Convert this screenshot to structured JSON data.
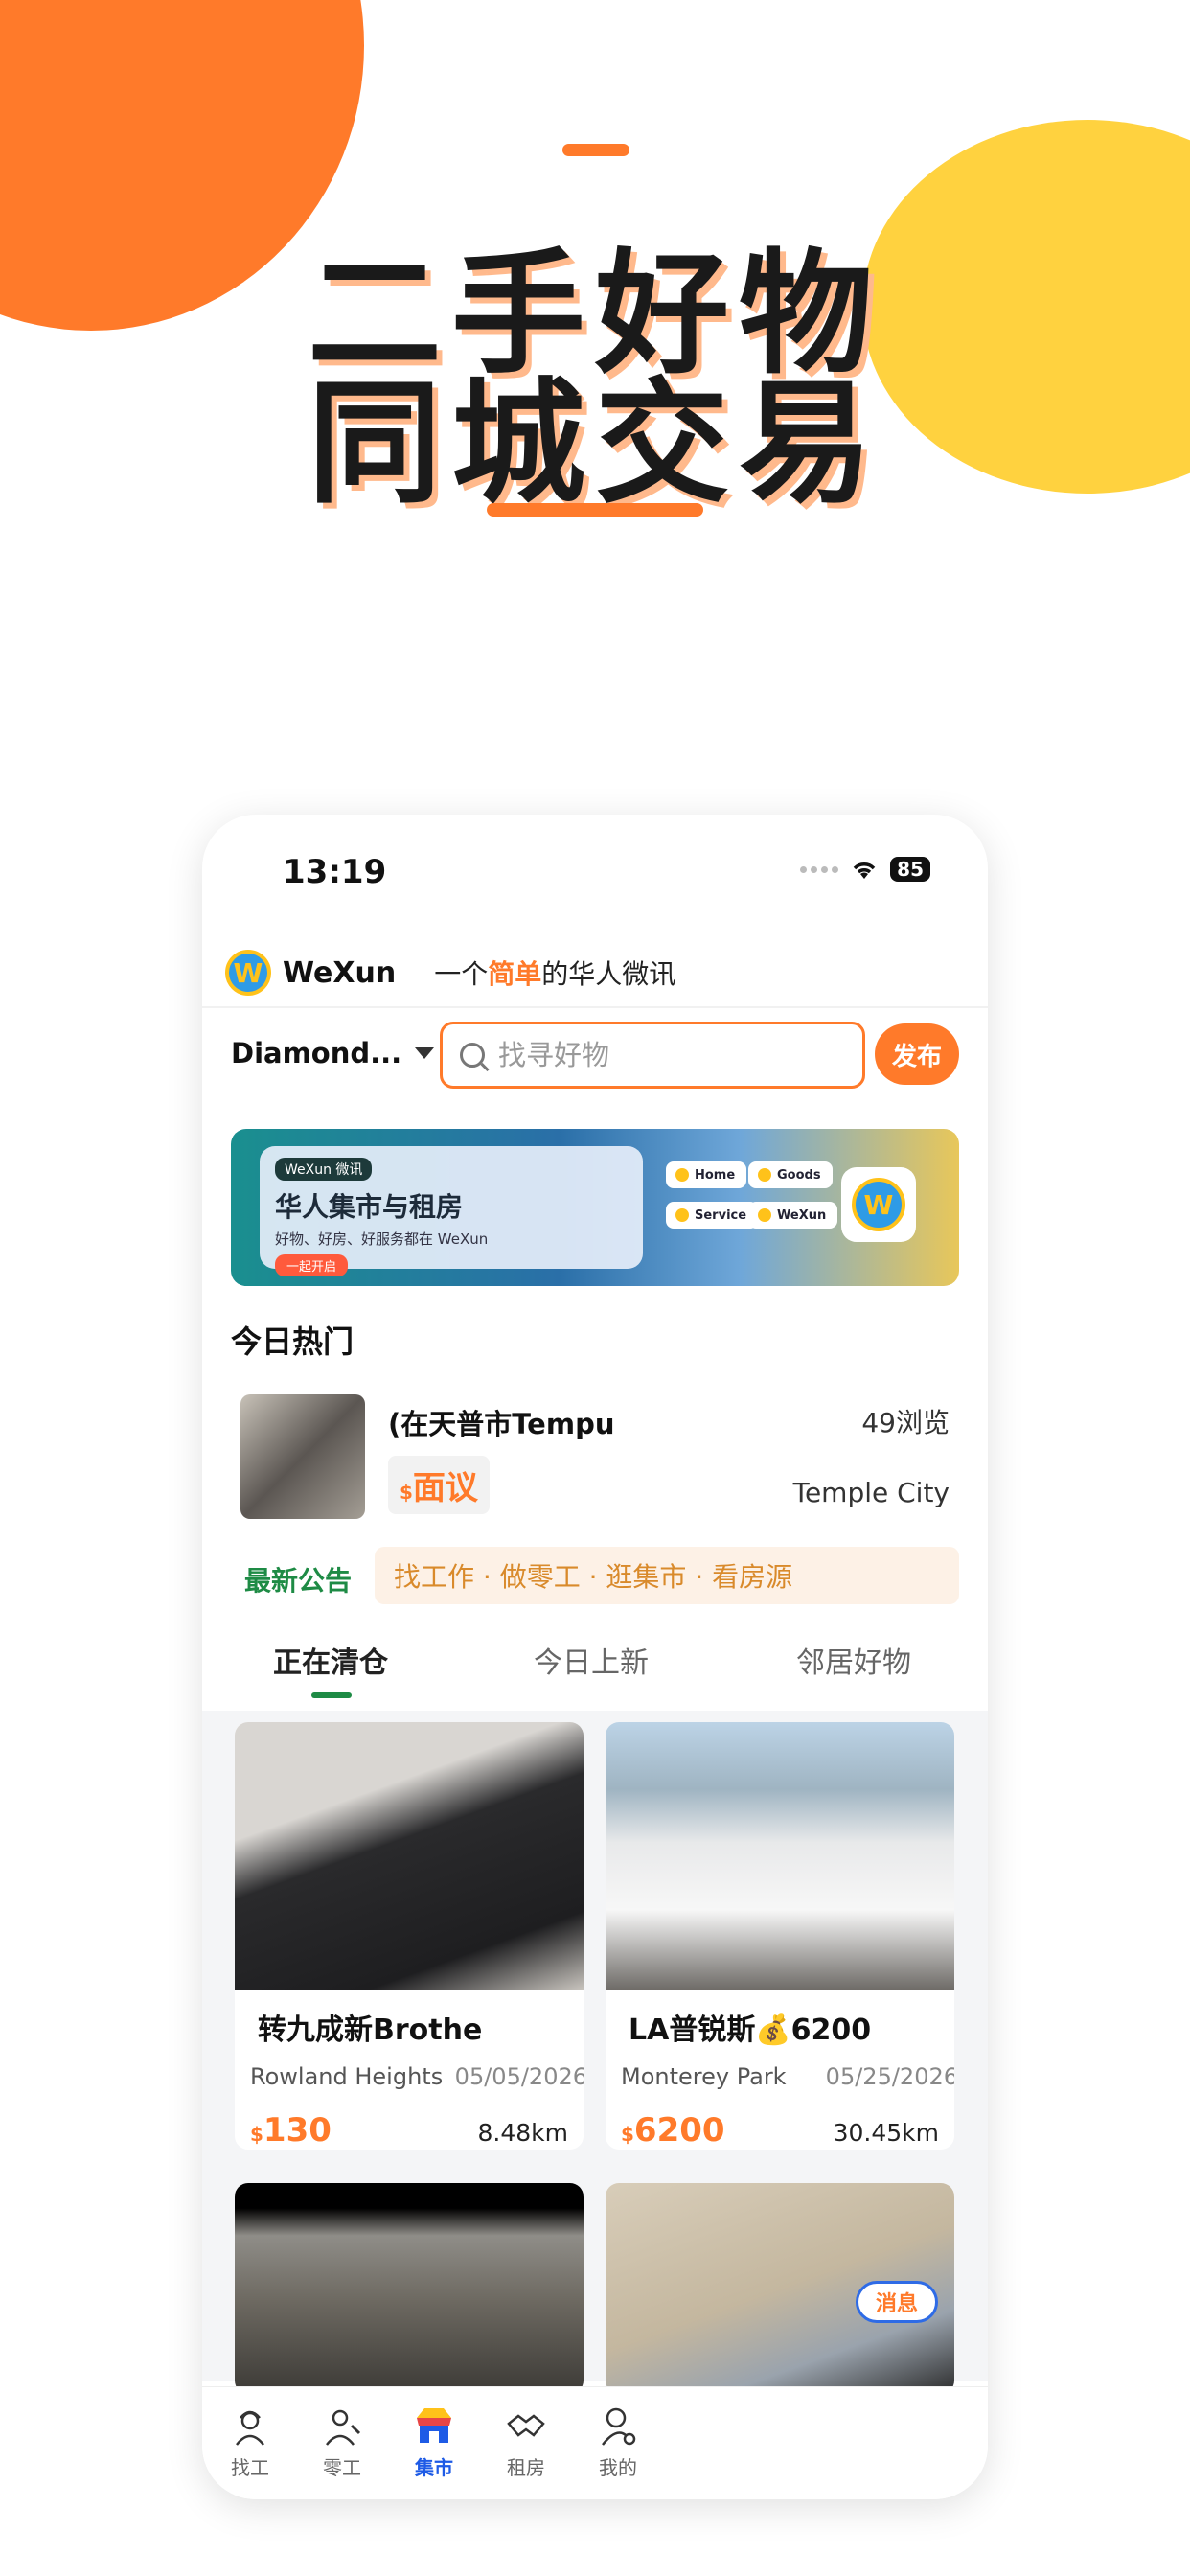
{
  "hero": {
    "line1": "二手好物",
    "line2": "同城交易"
  },
  "status_bar": {
    "time": "13:19",
    "battery": "85"
  },
  "brand": {
    "logo_letter": "W",
    "name": "WeXun",
    "slogan_pre": "一个",
    "slogan_highlight": "简单",
    "slogan_mid": "的",
    "slogan_post": "华人微讯"
  },
  "search_row": {
    "location": "Diamond...",
    "search_placeholder": "找寻好物",
    "publish_label": "发布"
  },
  "banner": {
    "tag": "WeXun 微讯",
    "title": "华人集市与租房",
    "subtitle": "好物、好房、好服务都在 WeXun",
    "button": "一起开启",
    "chips": [
      "Home",
      "Goods",
      "Service",
      "WeXun"
    ],
    "logo_letter": "W"
  },
  "hot": {
    "section_title": "今日热门",
    "item": {
      "title": "(在天普市Tempu",
      "views": "49浏览",
      "currency": "$",
      "price": "面议",
      "city": "Temple City"
    }
  },
  "notice": {
    "label": "最新公告",
    "text": "找工作 · 做零工 · 逛集市 · 看房源"
  },
  "tabs": [
    {
      "label": "正在清仓",
      "active": true
    },
    {
      "label": "今日上新",
      "active": false
    },
    {
      "label": "邻居好物",
      "active": false
    }
  ],
  "listings": [
    {
      "title": "转九成新Brothe",
      "location": "Rowland Heights",
      "date": "05/05/2026",
      "currency": "$",
      "price": "130",
      "distance": "8.48km"
    },
    {
      "title": "LA普锐斯💰6200",
      "location": "Monterey Park",
      "date": "05/25/2026",
      "currency": "$",
      "price": "6200",
      "distance": "30.45km"
    }
  ],
  "message_pill": "消息",
  "tabbar": [
    {
      "label": "找工",
      "icon": "worker-icon",
      "active": false
    },
    {
      "label": "零工",
      "icon": "repairman-icon",
      "active": false
    },
    {
      "label": "集市",
      "icon": "market-icon",
      "active": true
    },
    {
      "label": "租房",
      "icon": "handshake-icon",
      "active": false
    },
    {
      "label": "我的",
      "icon": "profile-icon",
      "active": false
    }
  ],
  "colors": {
    "brand_orange": "#FF7A2A",
    "brand_yellow": "#FFD23F",
    "notice_green": "#1E8B45",
    "tabbar_active": "#1E5BE6"
  }
}
